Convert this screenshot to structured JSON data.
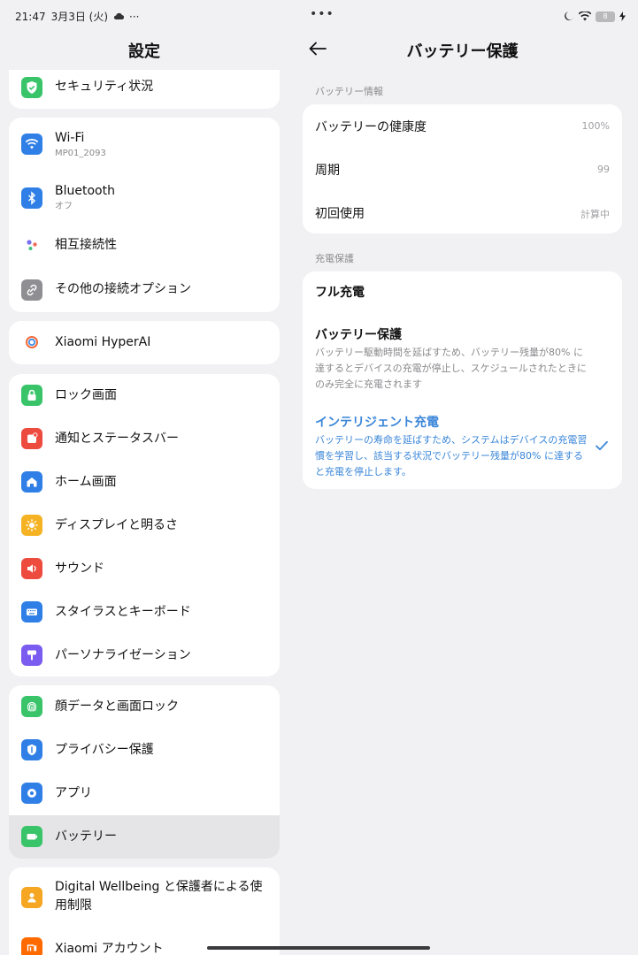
{
  "status_bar": {
    "time": "21:47",
    "date": "3月3日 (火)",
    "more": "···",
    "battery": "8"
  },
  "left": {
    "title": "設定",
    "items": {
      "security": {
        "label": "セキュリティ状況"
      },
      "wifi": {
        "label": "Wi-Fi",
        "sub": "MP01_2093"
      },
      "bluetooth": {
        "label": "Bluetooth",
        "sub": "オフ"
      },
      "interconnect": {
        "label": "相互接続性"
      },
      "other_conn": {
        "label": "その他の接続オプション"
      },
      "hyperai": {
        "label": "Xiaomi HyperAI"
      },
      "lock": {
        "label": "ロック画面"
      },
      "notif": {
        "label": "通知とステータスバー"
      },
      "home": {
        "label": "ホーム画面"
      },
      "display": {
        "label": "ディスプレイと明るさ"
      },
      "sound": {
        "label": "サウンド"
      },
      "stylus": {
        "label": "スタイラスとキーボード"
      },
      "personal": {
        "label": "パーソナライゼーション"
      },
      "face": {
        "label": "顔データと画面ロック"
      },
      "privacy": {
        "label": "プライバシー保護"
      },
      "apps": {
        "label": "アプリ"
      },
      "battery": {
        "label": "バッテリー"
      },
      "wellbeing": {
        "label": "Digital Wellbeing と保護者による使用制限"
      },
      "account": {
        "label": "Xiaomi アカウント"
      }
    }
  },
  "right": {
    "title": "バッテリー保護",
    "section_info": "バッテリー情報",
    "info": {
      "health_label": "バッテリーの健康度",
      "health_value": "100%",
      "cycle_label": "周期",
      "cycle_value": "99",
      "first_label": "初回使用",
      "first_value": "計算中"
    },
    "section_charge": "充電保護",
    "options": {
      "full": {
        "title": "フル充電"
      },
      "protect": {
        "title": "バッテリー保護",
        "desc": "バッテリー駆動時間を延ばすため、バッテリー残量が80% に達するとデバイスの充電が停止し、スケジュールされたときにのみ完全に充電されます"
      },
      "smart": {
        "title": "インテリジェント充電",
        "desc": "バッテリーの寿命を延ばすため、システムはデバイスの充電習慣を学習し、該当する状況でバッテリー残量が80% に達すると充電を停止します。"
      }
    }
  },
  "colors": {
    "accent": "#3a86d9",
    "selected_row": "#e5e5e7",
    "background": "#f1f1f3"
  }
}
